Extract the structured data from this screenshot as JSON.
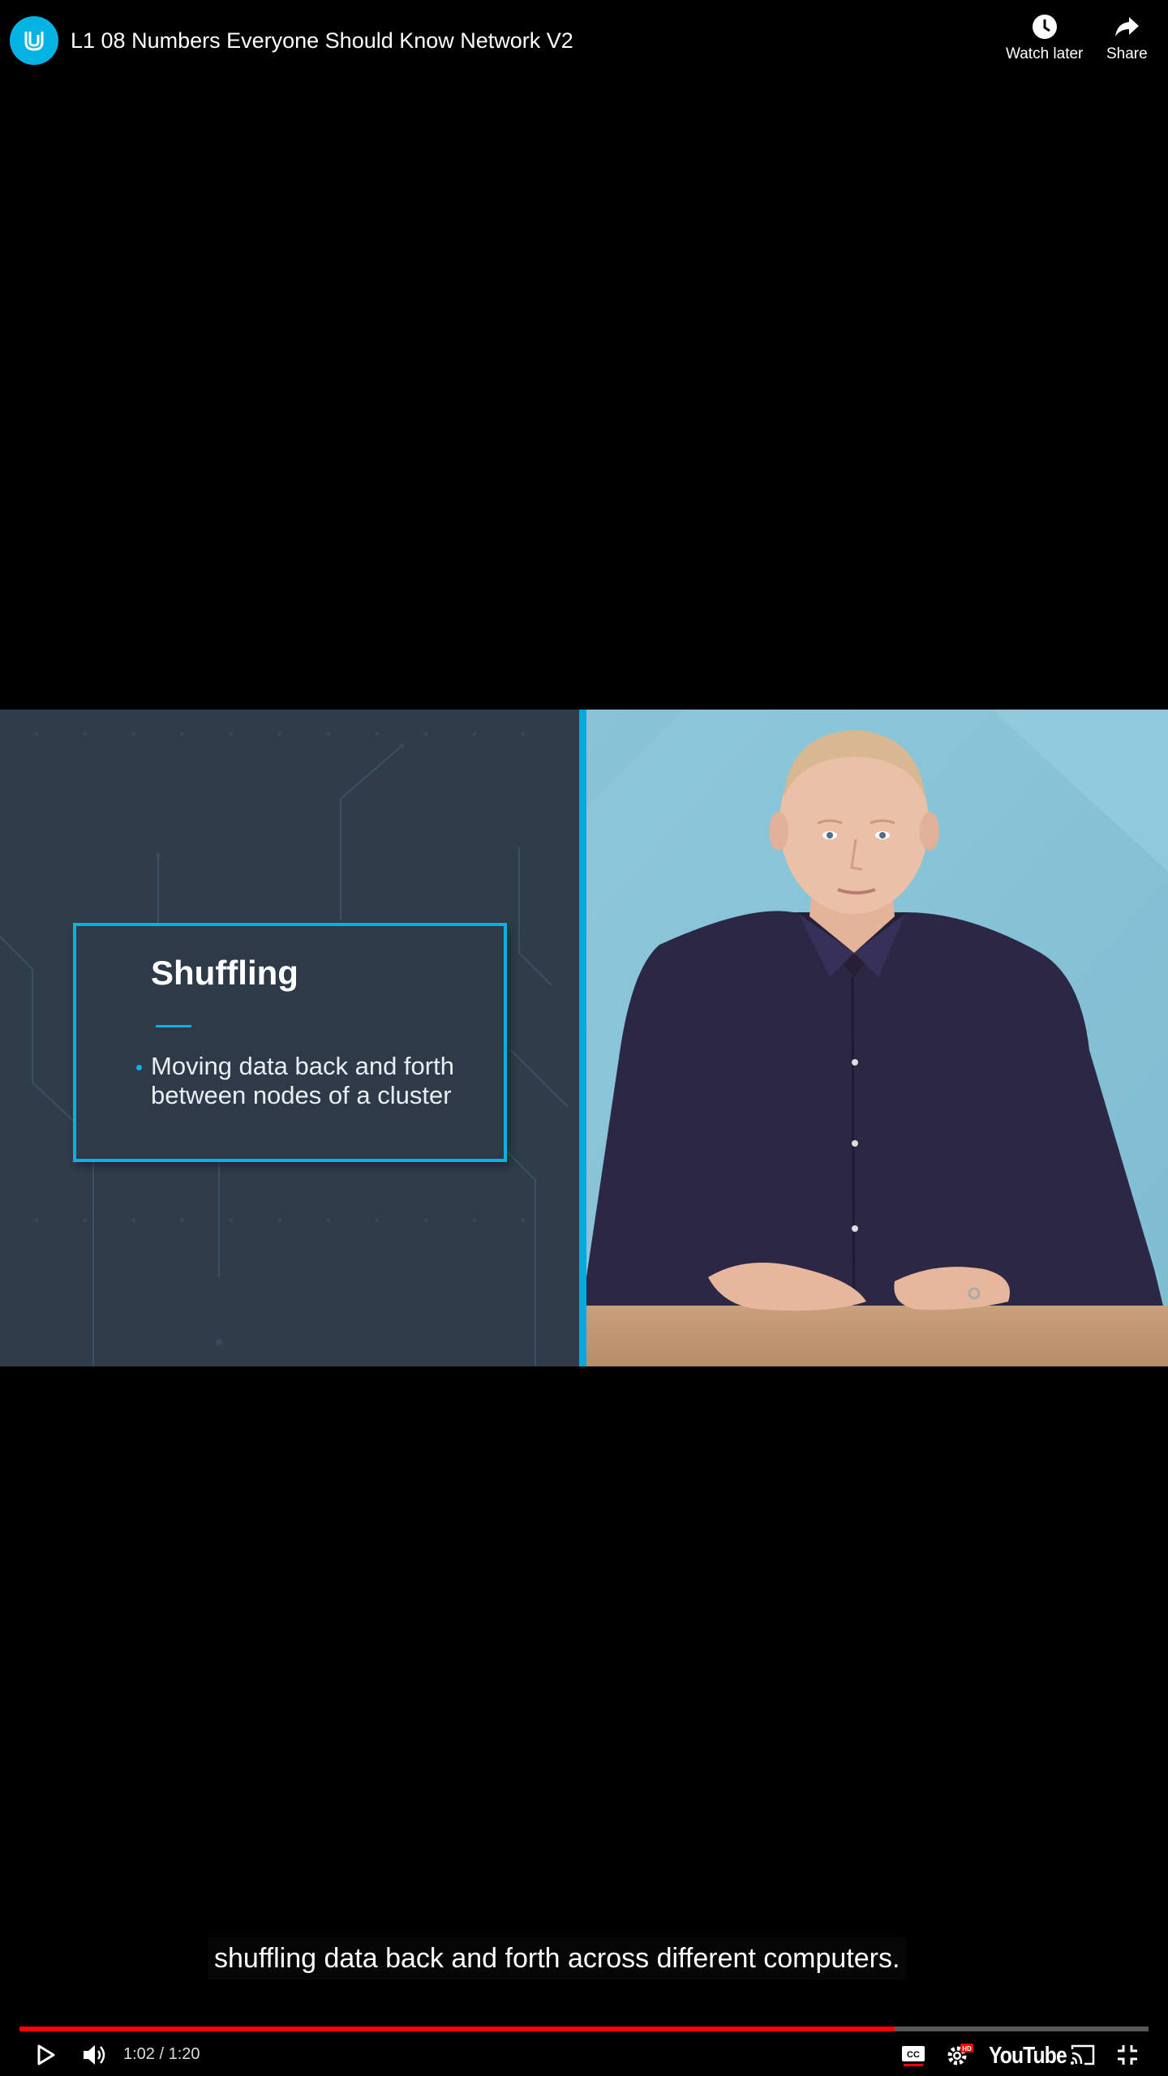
{
  "header": {
    "title": "L1 08 Numbers Everyone Should Know Network V2",
    "avatar_icon": "udacity-logo-icon",
    "watch_later_label": "Watch later",
    "share_label": "Share"
  },
  "slide": {
    "heading": "Shuffling",
    "bullet": "Moving data back and forth between nodes of a cluster"
  },
  "caption": "shuffling data back and forth across different computers.",
  "controls": {
    "time": "1:02 / 1:20",
    "progress_fraction": 0.775,
    "logo": "YouTube",
    "accent_color": "#ff0000"
  },
  "colors": {
    "brand": "#02b3e4",
    "slide_background": "#2f3d4b",
    "presenter_background": "#8cc4d8"
  }
}
